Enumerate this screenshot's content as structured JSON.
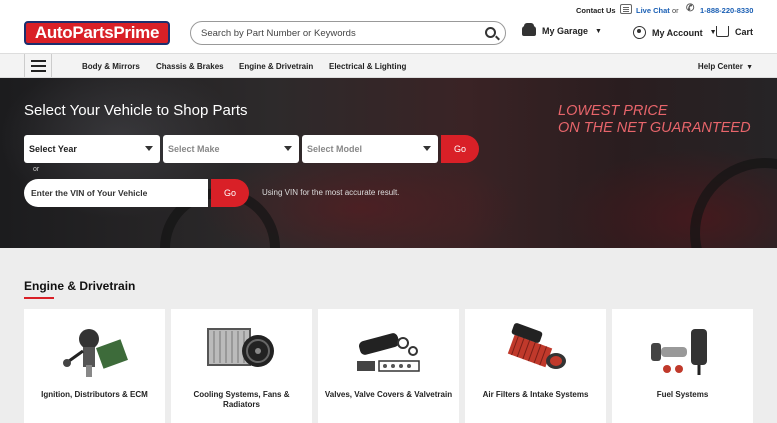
{
  "topbar": {
    "contact": "Contact Us",
    "livechat": "Live Chat",
    "or": "or",
    "phone": "1-888-220-8330"
  },
  "header": {
    "logo": "AutoPartsPrime",
    "search_placeholder": "Search by Part Number or Keywords",
    "garage": "My Garage",
    "account": "My Account",
    "cart": "Cart"
  },
  "nav": {
    "items": [
      "Body & Mirrors",
      "Chassis & Brakes",
      "Engine & Drivetrain",
      "Electrical & Lighting"
    ],
    "help": "Help Center"
  },
  "hero": {
    "title": "Select Your Vehicle to Shop Parts",
    "promo_line1": "LOWEST PRICE",
    "promo_line2": "ON THE NET GUARANTEED",
    "year": "Select Year",
    "make": "Select Make",
    "model": "Select Model",
    "go": "Go",
    "or": "or",
    "vin_placeholder": "Enter the VIN of Your Vehicle",
    "vin_go": "Go",
    "vin_note": "Using VIN for the most accurate result."
  },
  "section": {
    "title": "Engine & Drivetrain",
    "cards": [
      {
        "label": "Ignition, Distributors & ECM",
        "icon": "distributor-icon"
      },
      {
        "label": "Cooling Systems, Fans & Radiators",
        "icon": "radiator-icon"
      },
      {
        "label": "Valves, Valve Covers & Valvetrain",
        "icon": "valve-cover-icon"
      },
      {
        "label": "Air Filters & Intake Systems",
        "icon": "air-filter-icon"
      },
      {
        "label": "Fuel Systems",
        "icon": "fuel-pump-icon"
      }
    ]
  },
  "colors": {
    "brand_red": "#d92027",
    "brand_navy": "#1b2f6e",
    "link_blue": "#1a5fb4",
    "promo_red": "#e8656b"
  }
}
